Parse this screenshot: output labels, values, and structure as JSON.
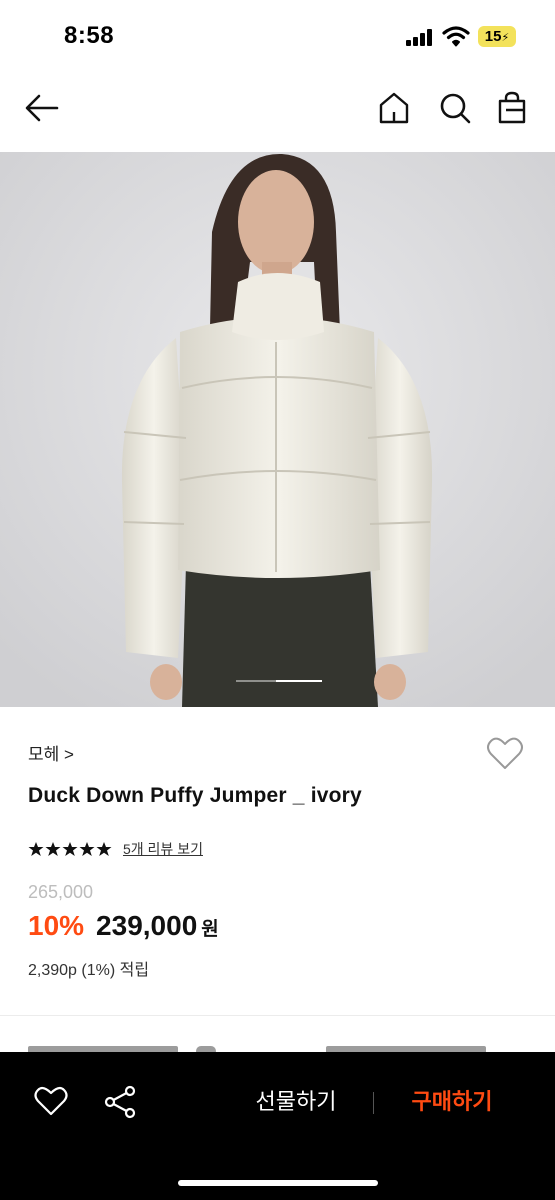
{
  "status_bar": {
    "time": "8:58",
    "battery": "15"
  },
  "nav": {
    "back_icon": "back-arrow-icon",
    "home_icon": "home-icon",
    "search_icon": "search-icon",
    "bag_icon": "shopping-bag-icon"
  },
  "product": {
    "brand": "모헤 >",
    "name": "Duck Down Puffy Jumper _ ivory",
    "rating": 5,
    "review_link": "5개 리뷰 보기",
    "original_price": "265,000",
    "discount": "10%",
    "sale_price": "239,000",
    "currency": "원",
    "points": "2,390p (1%) 적립"
  },
  "bottom_bar": {
    "gift_label": "선물하기",
    "buy_label": "구매하기"
  },
  "colors": {
    "accent": "#ff4b12",
    "star": "#111111",
    "background": "#ffffff",
    "bottom_bar": "#000000"
  }
}
